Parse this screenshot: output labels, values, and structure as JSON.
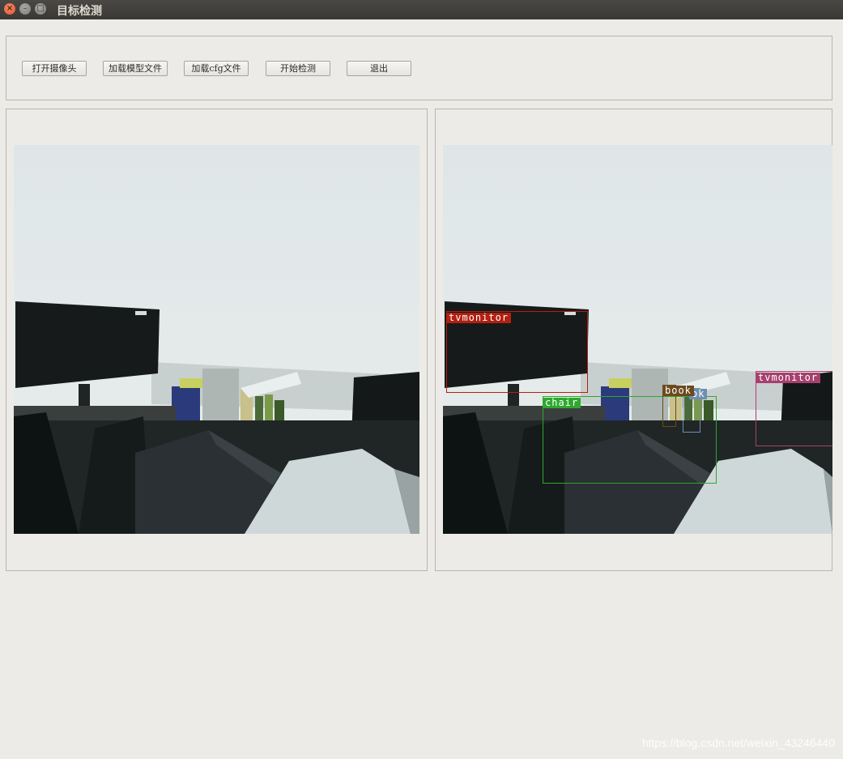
{
  "window": {
    "title": "目标检测",
    "close_glyph": "×",
    "min_glyph": "–",
    "max_glyph": "□"
  },
  "toolbar": {
    "buttons": [
      {
        "label": "打开摄像头"
      },
      {
        "label": "加载模型文件"
      },
      {
        "label": "加载cfg文件"
      },
      {
        "label": "开始检测"
      },
      {
        "label": "退出"
      }
    ]
  },
  "detections": [
    {
      "label": "tvmonitor",
      "color": "#b22010"
    },
    {
      "label": "chair",
      "color": "#2ea82e"
    },
    {
      "label": "book",
      "color": "#6b4a1e"
    },
    {
      "label": "ok",
      "color": "#6f8fb0"
    },
    {
      "label": "tvmonitor",
      "color": "#a8406e"
    }
  ],
  "watermark": "https://blog.csdn.net/weixin_43246440"
}
